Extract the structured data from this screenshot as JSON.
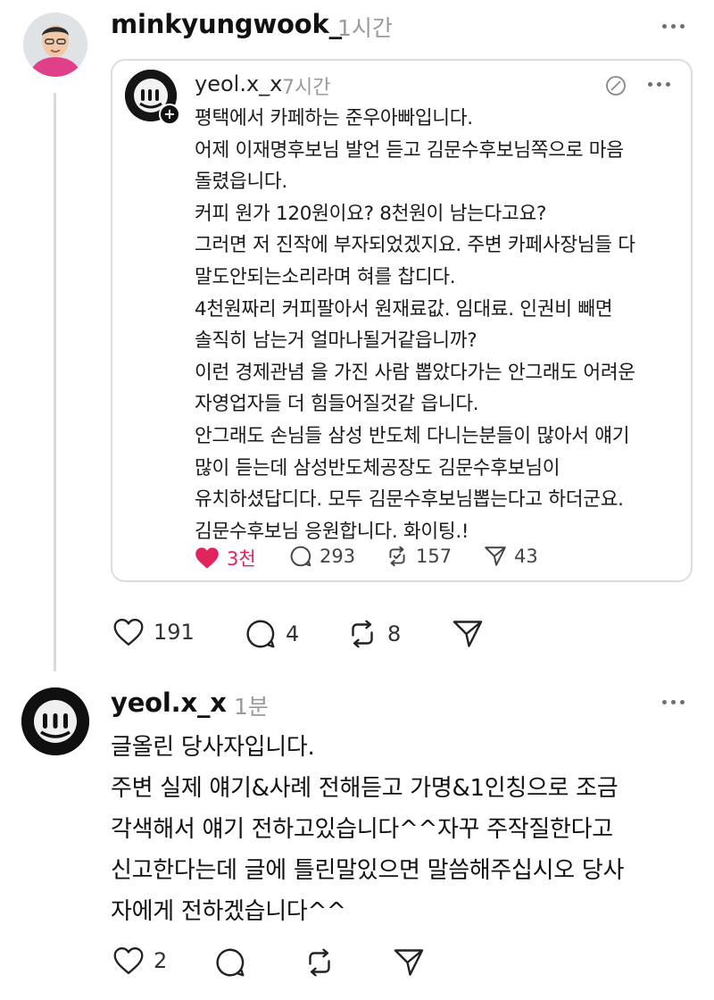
{
  "post": {
    "username": "minkyungwook_",
    "time": "1시간",
    "quoted": {
      "username": "yeol.x_x",
      "time": "7시간",
      "lines": [
        "평택에서 카페하는 준우아빠입니다.",
        "어제 이재명후보님 발언 듣고 김문수후보님쪽으로 마음",
        "돌렸읍니다.",
        "커피 원가 120원이요? 8천원이 남는다고요?",
        "그러면 저 진작에 부자되었겠지요. 주변 카페사장님들 다",
        "말도안되는소리라며 혀를 찹디다.",
        "4천원짜리 커피팔아서 원재료값. 임대료. 인권비 빼면",
        "솔직히 남는거 얼마나될거같읍니까?",
        "이런 경제관념 을 가진 사람 뽑았다가는 안그래도 어려운",
        "자영업자들 더 힘들어질것같 읍니다.",
        "안그래도 손님들 삼성 반도체 다니는분들이 많아서 얘기",
        "많이 듣는데 삼성반도체공장도 김문수후보님이",
        "유치하셨답디다. 모두 김문수후보님뽑는다고 하더군요.",
        "김문수후보님 응원합니다. 화이팅.!"
      ],
      "stats": {
        "likes": "3천",
        "replies": "293",
        "reposts": "157",
        "shares": "43"
      }
    },
    "stats": {
      "likes": "191",
      "replies": "4",
      "reposts": "8"
    }
  },
  "reply": {
    "username": "yeol.x_x",
    "time": "1분",
    "lines": [
      "글올린 당사자입니다.",
      "주변 실제 얘기&사례 전해듣고 가명&1인칭으로 조금",
      "각색해서 얘기 전하고있습니다^^자꾸 주작질한다고",
      "신고한다는데 글에 틀린말있으면 말씀해주십시오 당사",
      "자에게 전하겠습니다^^"
    ],
    "stats": {
      "likes": "2"
    }
  },
  "colors": {
    "like_active": "#e0245e",
    "muted": "#9a9a9a",
    "border": "#dddddd"
  }
}
